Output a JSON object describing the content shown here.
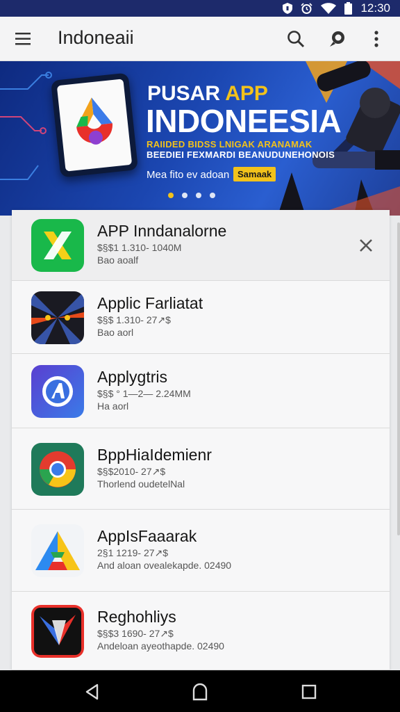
{
  "status_bar": {
    "time": "12:30"
  },
  "app_bar": {
    "title": "Indoneaii"
  },
  "banner": {
    "title_line1_prefix": "PUSAR ",
    "title_line1_accent": "APP",
    "title_line2": "INDONEESIA",
    "subtitle_line1": "RAIIDED BIDSS LNIGAK ARANAMAK",
    "subtitle_line2": "BEEDIEI FEXMARDI BEANUDUNEHONOIS",
    "cta_text": "Mea fito ev adoan",
    "cta_button": "Samaak",
    "slide_count": 4,
    "active_slide": 1
  },
  "apps": [
    {
      "name": "APP Inndanalorne",
      "meta1": "$§$1 1.310- 1040M",
      "meta2": "Bao aoalf",
      "icon": "x-app-icon",
      "colors": [
        "#19b84a",
        "#f4d019"
      ],
      "closable": true
    },
    {
      "name": "Applic Farliatat",
      "meta1": "$§$ 1.310- 27↗$",
      "meta2": "Bao aorl",
      "icon": "warp-tunnel-icon",
      "colors": [
        "#1a1a22",
        "#e74a1a"
      ],
      "closable": false
    },
    {
      "name": "Applygtris",
      "meta1": "$§$ ° 1—2— 2.24MM",
      "meta2": "Ha aorl",
      "icon": "compass-a-icon",
      "colors": [
        "#5a3fd0",
        "#3a7be8"
      ],
      "closable": false
    },
    {
      "name": "BppHiaIdemienr",
      "meta1": "$§$2010- 27↗$",
      "meta2": "Thorlend oudetelNal",
      "icon": "chrome-like-icon",
      "colors": [
        "#e33b2e",
        "#f7c418"
      ],
      "closable": false
    },
    {
      "name": "AppIsFaaarak",
      "meta1": "2§1 1219- 27↗$",
      "meta2": "And aloan ovealekapde. 02490",
      "icon": "triangle-a-icon",
      "colors": [
        "#2c8af0",
        "#f7c418"
      ],
      "closable": false
    },
    {
      "name": "Reghohliys",
      "meta1": "$§$3 1690- 27↗$",
      "meta2": "Andeloan ayeothapde. 02490",
      "icon": "red-kite-icon",
      "colors": [
        "#111111",
        "#e8302a"
      ],
      "closable": false
    }
  ]
}
